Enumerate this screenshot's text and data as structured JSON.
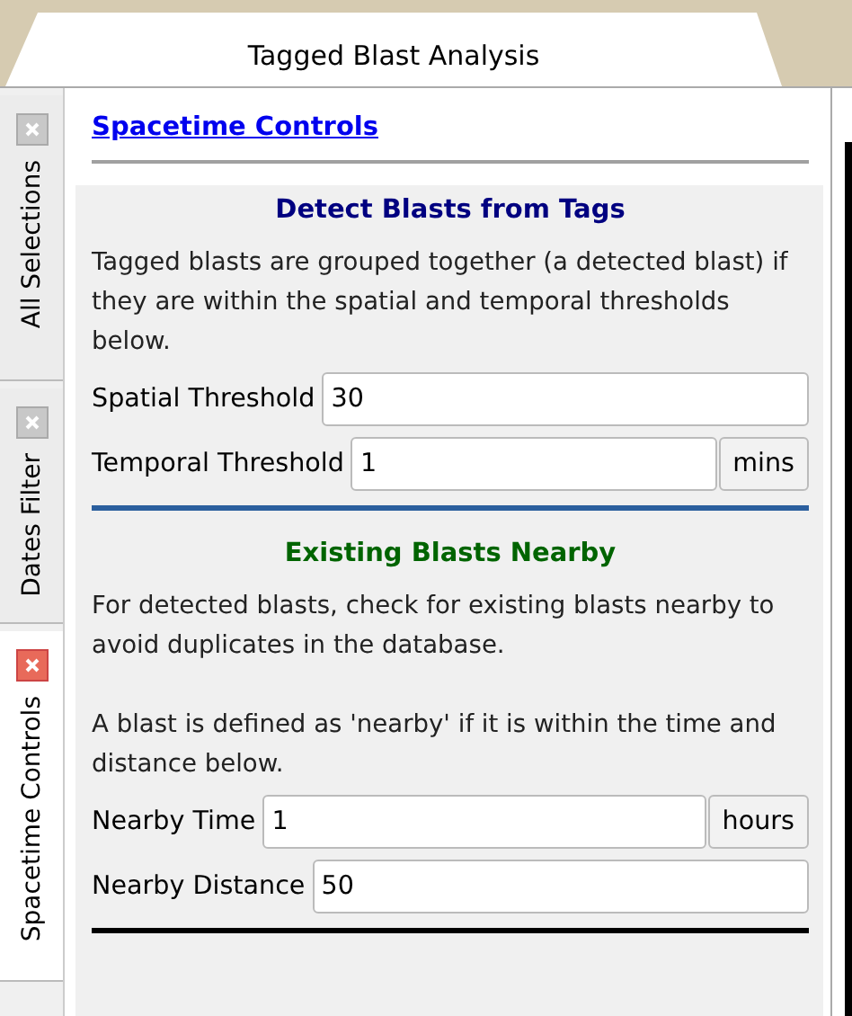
{
  "window": {
    "title": "Tagged Blast Analysis"
  },
  "tabs": [
    {
      "label": "All Selections",
      "selected": false
    },
    {
      "label": "Dates Filter",
      "selected": false
    },
    {
      "label": "Spacetime Controls",
      "selected": true
    }
  ],
  "panel": {
    "heading": "Spacetime Controls",
    "sections": [
      {
        "kind": "inner",
        "title": "Detect Blasts from Tags",
        "color": "#000080",
        "paragraphs": [
          "Tagged blasts are grouped together (a detected blast) if they are within the spatial and temporal thresholds below."
        ],
        "fields": [
          {
            "label": "Spatial Threshold",
            "value": "30"
          },
          {
            "label": "Temporal Threshold",
            "value": "1",
            "unit": "mins"
          }
        ]
      },
      {
        "kind": "last",
        "title": "Existing Blasts Nearby",
        "color": "#006400",
        "paragraphs": [
          "For detected blasts, check for existing blasts nearby to avoid duplicates in the database.",
          "A blast is defined as 'nearby' if it is within the time and distance below."
        ],
        "fields": [
          {
            "label": "Nearby Time",
            "value": "1",
            "unit": "hours"
          },
          {
            "label": "Nearby Distance",
            "value": "50"
          }
        ]
      }
    ]
  }
}
